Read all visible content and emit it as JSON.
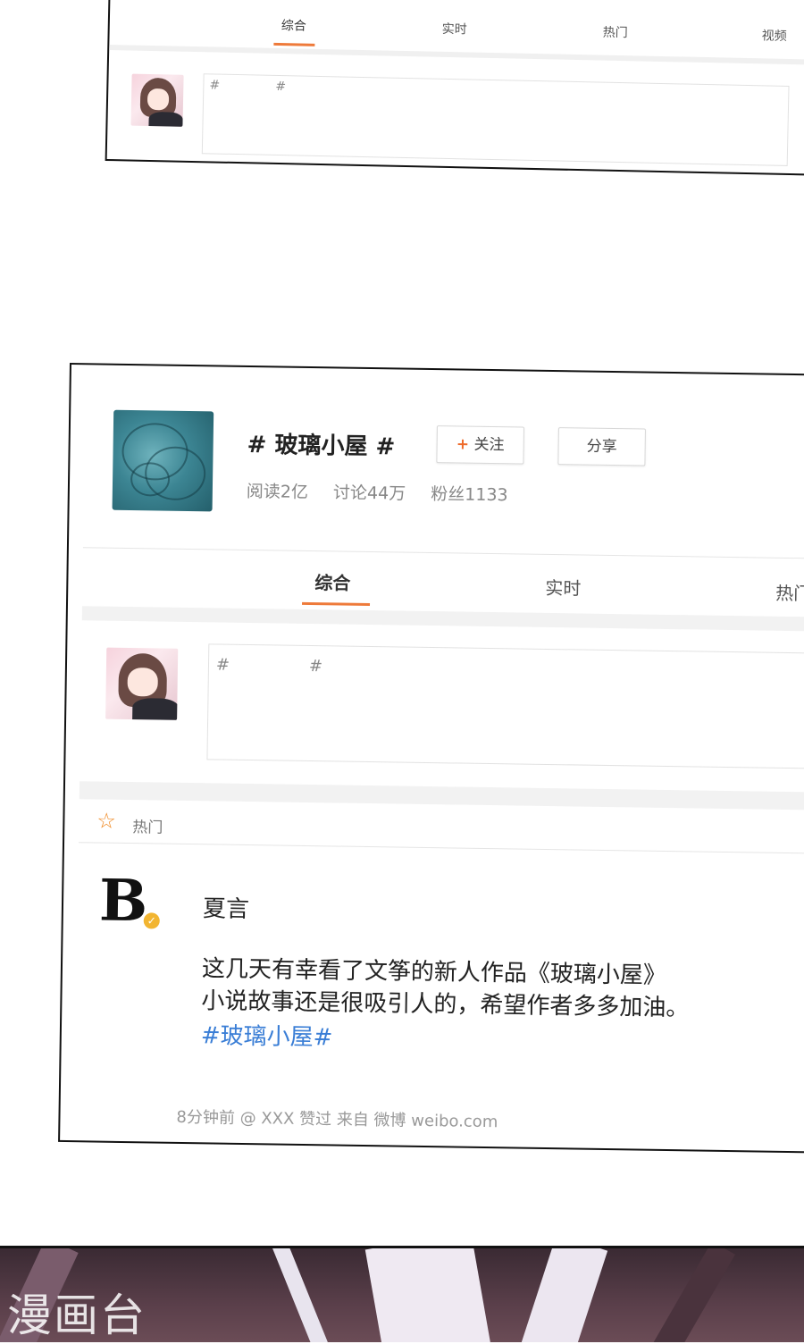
{
  "top_panel": {
    "tabs": [
      "综合",
      "实时",
      "热门",
      "视频"
    ],
    "post_hashes": [
      "#",
      "#"
    ]
  },
  "main_panel": {
    "topic_title": "# 玻璃小屋 #",
    "follow_icon": "+",
    "follow_label": "关注",
    "share_label": "分享",
    "stats": {
      "reads": "阅读2亿",
      "discussions": "讨论44万",
      "fans": "粉丝1133"
    },
    "tabs": [
      "综合",
      "实时",
      "热门"
    ],
    "post_hashes": [
      "#",
      "#"
    ],
    "hot_section_label": "热门",
    "post": {
      "avatar_letter": "B",
      "user_name": "夏言",
      "text_line1": "这几天有幸看了文筝的新人作品《玻璃小屋》",
      "text_line2": "小说故事还是很吸引人的，希望作者多多加油。",
      "tag": "#玻璃小屋#",
      "meta": "8分钟前 @ XXX 赞过 来自 微博 weibo.com"
    }
  },
  "watermark": "漫画台",
  "colors": {
    "accent_orange": "#ee7a3a",
    "link_blue": "#3a7ed6",
    "verify_yellow": "#f2b531"
  },
  "icons": [
    "star-icon",
    "plus-icon",
    "verify-badge-icon"
  ]
}
